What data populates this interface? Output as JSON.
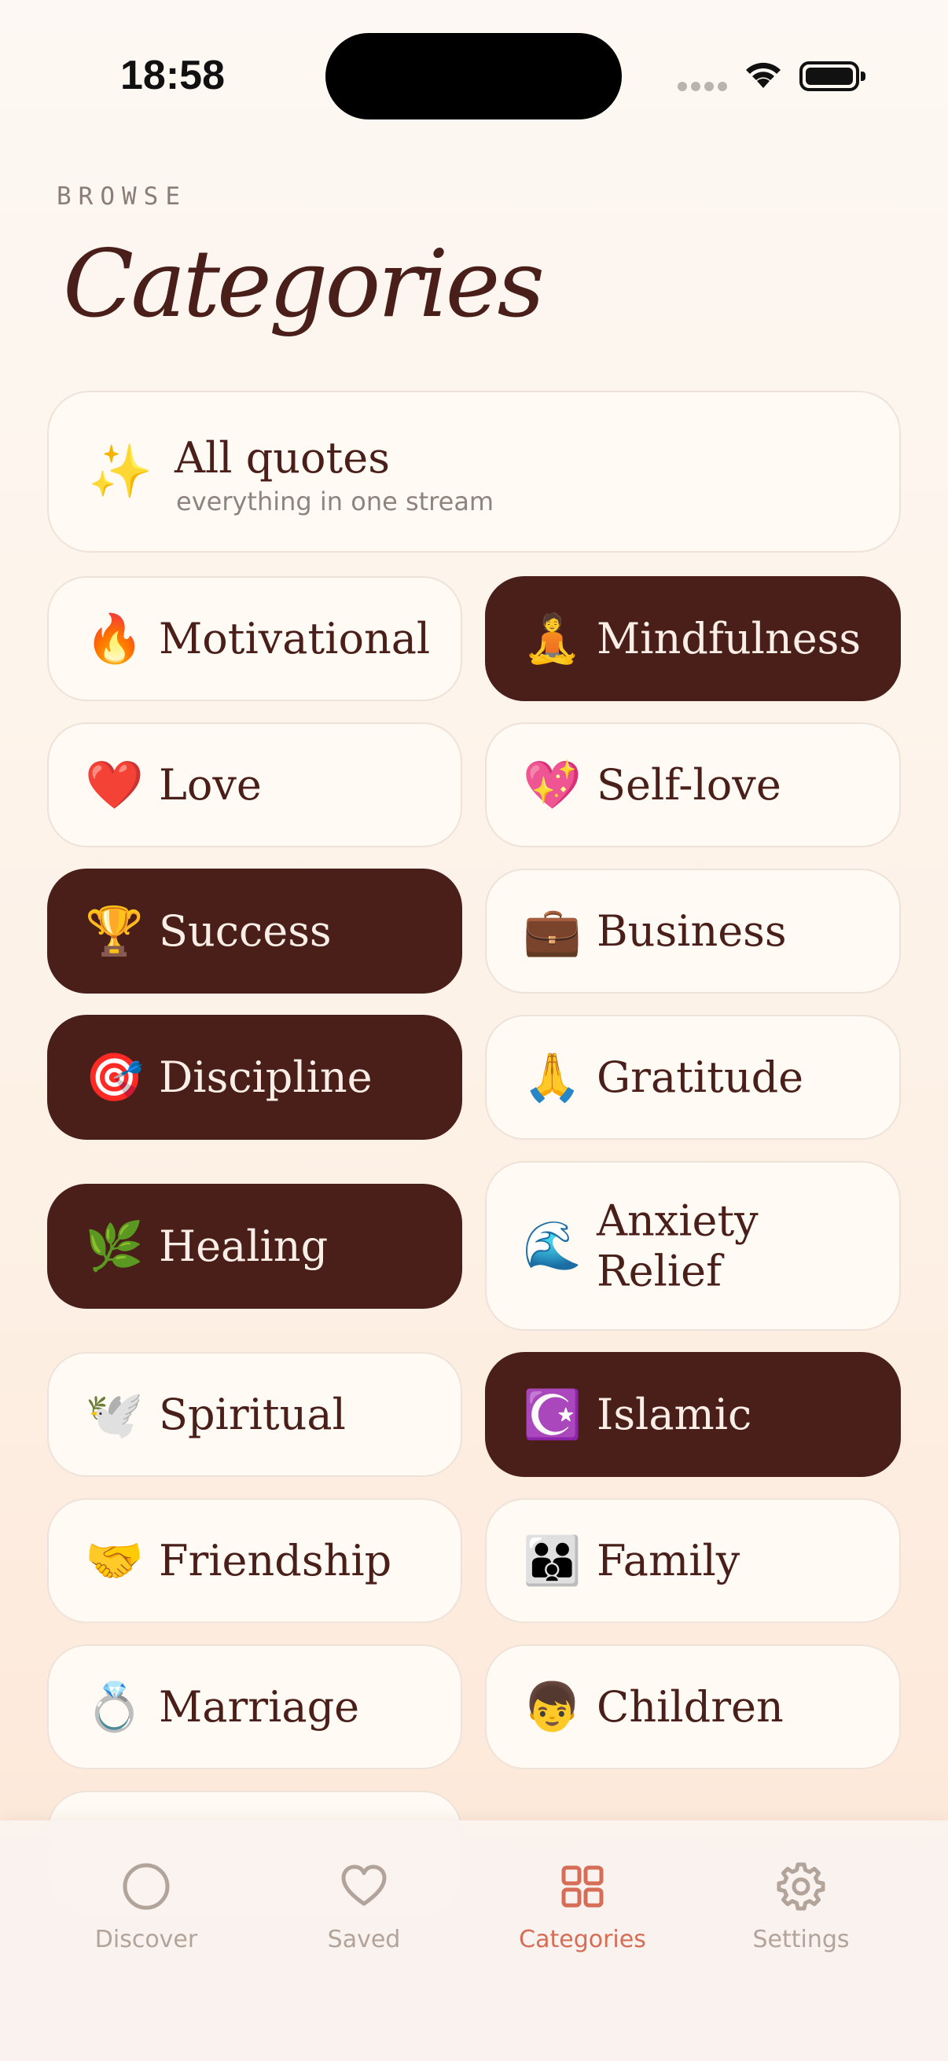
{
  "status_bar": {
    "time": "18:58"
  },
  "header": {
    "eyebrow": "BROWSE",
    "title": "Categories"
  },
  "all_card": {
    "emoji": "✨",
    "label": "All quotes",
    "subtitle": "everything in one stream"
  },
  "categories": [
    {
      "emoji": "🔥",
      "label": "Motivational",
      "active": false
    },
    {
      "emoji": "🧘",
      "label": "Mindfulness",
      "active": true
    },
    {
      "emoji": "❤️",
      "label": "Love",
      "active": false
    },
    {
      "emoji": "💖",
      "label": "Self-love",
      "active": false
    },
    {
      "emoji": "🏆",
      "label": "Success",
      "active": true
    },
    {
      "emoji": "💼",
      "label": "Business",
      "active": false
    },
    {
      "emoji": "🎯",
      "label": "Discipline",
      "active": true
    },
    {
      "emoji": "🙏",
      "label": "Gratitude",
      "active": false
    },
    {
      "emoji": "🌿",
      "label": "Healing",
      "active": true
    },
    {
      "emoji": "🌊",
      "label": "Anxiety Relief",
      "label_line1": "Anxiety",
      "label_line2": "Relief",
      "active": false
    },
    {
      "emoji": "🕊️",
      "label": "Spiritual",
      "active": false
    },
    {
      "emoji": "☪️",
      "label": "Islamic",
      "active": true
    },
    {
      "emoji": "🤝",
      "label": "Friendship",
      "active": false
    },
    {
      "emoji": "👪",
      "label": "Family",
      "active": false
    },
    {
      "emoji": "💍",
      "label": "Marriage",
      "active": false
    },
    {
      "emoji": "👦",
      "label": "Children",
      "active": false
    },
    {
      "emoji": "",
      "label": "",
      "active": false
    }
  ],
  "tab_bar": {
    "tabs": [
      {
        "label": "Discover",
        "icon": "circle-icon",
        "active": false
      },
      {
        "label": "Saved",
        "icon": "heart-icon",
        "active": false
      },
      {
        "label": "Categories",
        "icon": "grid-icon",
        "active": true
      },
      {
        "label": "Settings",
        "icon": "gear-icon",
        "active": false
      }
    ]
  },
  "colors": {
    "accent": "#d66d57",
    "dark": "#4a1f1a",
    "card": "#fffaf4",
    "muted": "#b3a49b"
  }
}
